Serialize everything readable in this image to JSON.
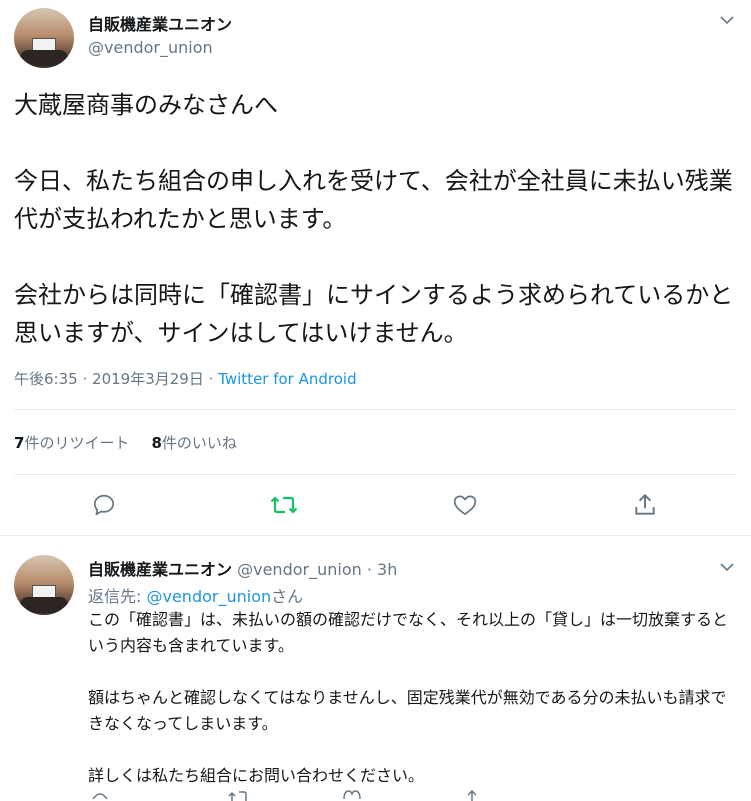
{
  "main_tweet": {
    "author_name": "自販機産業ユニオン",
    "author_handle": "@vendor_union",
    "text": "大蔵屋商事のみなさんへ\n\n今日、私たち組合の申し入れを受けて、会社が全社員に未払い残業代が支払われたかと思います。\n\n会社からは同時に「確認書」にサインするよう求められているかと思いますが、サインはしてはいけません。",
    "time": "午後6:35",
    "date": "2019年3月29日",
    "separator": "·",
    "source": "Twitter for Android",
    "retweet_count": "7",
    "retweet_label": "件のリツイート",
    "like_count": "8",
    "like_label": "件のいいね"
  },
  "reply_tweet": {
    "author_name": "自販機産業ユニオン",
    "author_handle": "@vendor_union",
    "separator": "·",
    "time_ago": "3h",
    "reply_to_prefix": "返信先: ",
    "reply_to_handle": "@vendor_union",
    "reply_to_suffix": "さん",
    "text": "この「確認書」は、未払いの額の確認だけでなく、それ以上の「貸し」は一切放棄するという内容も含まれています。\n\n額はちゃんと確認しなくてはなりませんし、固定残業代が無効である分の未払いも請求できなくなってしまいます。\n\n詳しくは私たち組合にお問い合わせください。"
  },
  "icons": {
    "menu": "chevron-down-icon",
    "reply": "reply-icon",
    "retweet": "retweet-icon",
    "like": "heart-icon",
    "share": "share-icon"
  },
  "colors": {
    "link": "#1b95e0",
    "retweet_active": "#17bf63",
    "muted": "#657786",
    "text": "#14171a"
  }
}
